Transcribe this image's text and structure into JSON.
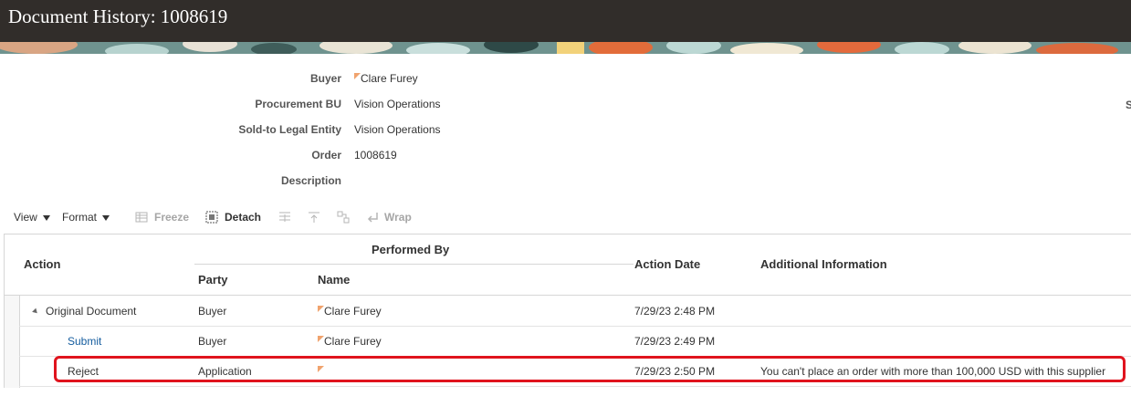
{
  "header": {
    "title": "Document History: 1008619"
  },
  "summary": {
    "buyer": {
      "label": "Buyer",
      "value": "Clare Furey"
    },
    "procurement_bu": {
      "label": "Procurement BU",
      "value": "Vision Operations"
    },
    "sold_to": {
      "label": "Sold-to Legal Entity",
      "value": "Vision Operations"
    },
    "order": {
      "label": "Order",
      "value": "1008619"
    },
    "description": {
      "label": "Description",
      "value": ""
    },
    "right_cut_label": "S"
  },
  "toolbar": {
    "view": "View",
    "format": "Format",
    "freeze": "Freeze",
    "detach": "Detach",
    "wrap": "Wrap"
  },
  "table": {
    "headers": {
      "action": "Action",
      "performed_by": "Performed By",
      "party": "Party",
      "name": "Name",
      "action_date": "Action Date",
      "additional_info": "Additional Information"
    },
    "rows": [
      {
        "action": "Original Document",
        "party": "Buyer",
        "name": "Clare Furey",
        "date": "7/29/23 2:48 PM",
        "info": ""
      },
      {
        "action": "Submit",
        "party": "Buyer",
        "name": "Clare Furey",
        "date": "7/29/23 2:49 PM",
        "info": ""
      },
      {
        "action": "Reject",
        "party": "Application",
        "name": "",
        "date": "7/29/23 2:50 PM",
        "info": "You can't place an order with more than 100,000 USD with this supplier"
      }
    ]
  },
  "colors": {
    "header_bg": "#312d2a",
    "link": "#145c9e",
    "highlight": "#e0141e"
  }
}
